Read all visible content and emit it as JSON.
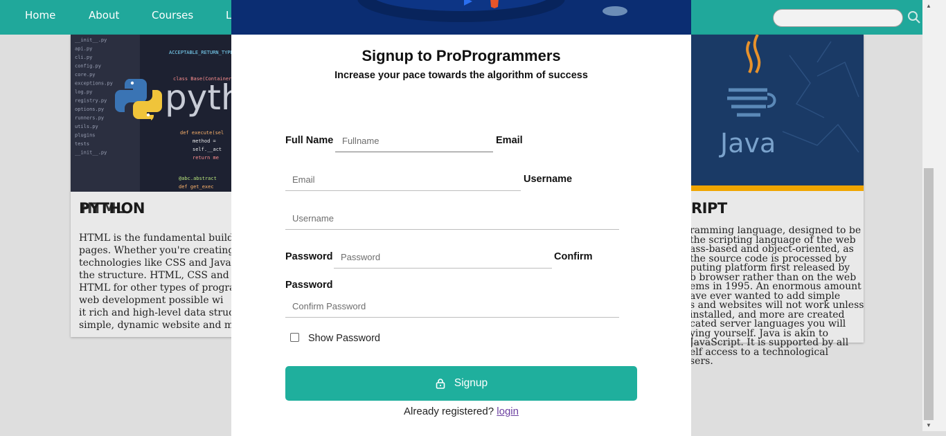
{
  "nav": {
    "items": [
      "Home",
      "About",
      "Courses",
      "L"
    ],
    "search_placeholder": ""
  },
  "cards": {
    "python": {
      "logo_text": "pyth",
      "title_a": "PYTHON",
      "title_b": "HTML",
      "text_lines": [
        "HTML is the fundamental building",
        "pages. Whether you're creating",
        "technologies like CSS and JavaS",
        "the structure. HTML, CSS and Java",
        "HTML for other types of program",
        "web development possible wi",
        "it rich and high-level data struc",
        "simple, dynamic website and more"
      ],
      "code_lines": [
        "ACCEPTABLE_RETURN_TYPES =",
        "class Base(ContainerAw",
        "def execute(sel",
        "method =",
        "self.__act",
        "return me",
        "@abc.abstract",
        "def get_exec"
      ],
      "file_lines": [
        "__init__.py",
        "api.py",
        "cli.py",
        "config.py",
        "core.py",
        "exceptions.py",
        "log.py",
        "registry.py",
        "options.py",
        "runners.py",
        "utils.py",
        "plugins",
        "tests",
        "__init__.py"
      ]
    },
    "java": {
      "logo_text": "Java",
      "title": "RIPT",
      "text_lines": [
        "ramming language, designed to be",
        "the scripting language of the web",
        "ass-based and object-oriented, as",
        "the source code is processed by",
        "puting platform first released by",
        "b browser rather than on the web",
        "ems in 1995. An enormous amount",
        "ave ever wanted to add simple",
        "s and websites will not work unless",
        "installed, and more are created",
        "cated server languages you will",
        "ying yourself. Java is akin to",
        "JavaScript. It is supported by all",
        "elf access to a technological",
        "sers."
      ]
    }
  },
  "modal": {
    "title": "Signup to ProProgrammers",
    "subtitle": "Increase your pace towards the algorithm of success",
    "fields": {
      "fullname_label": "Full Name",
      "fullname_placeholder": "Fullname",
      "email_label": "Email",
      "email_placeholder": "Email",
      "username_label": "Username",
      "username_placeholder": "Username",
      "password_label": "Password",
      "password_placeholder": "Password",
      "confirm_label_1": "Confirm",
      "confirm_label_2": "Password",
      "confirm_placeholder": "Confirm Password"
    },
    "show_password_label": "Show Password",
    "show_password_checked": false,
    "signup_label": "Signup",
    "registered_text": "Already registered?",
    "login_label": "login"
  },
  "colors": {
    "nav_bg": "#20a89b",
    "button_bg": "#1faf9d",
    "banner_bg": "#0a2a6e",
    "link": "#6b3fa0"
  }
}
